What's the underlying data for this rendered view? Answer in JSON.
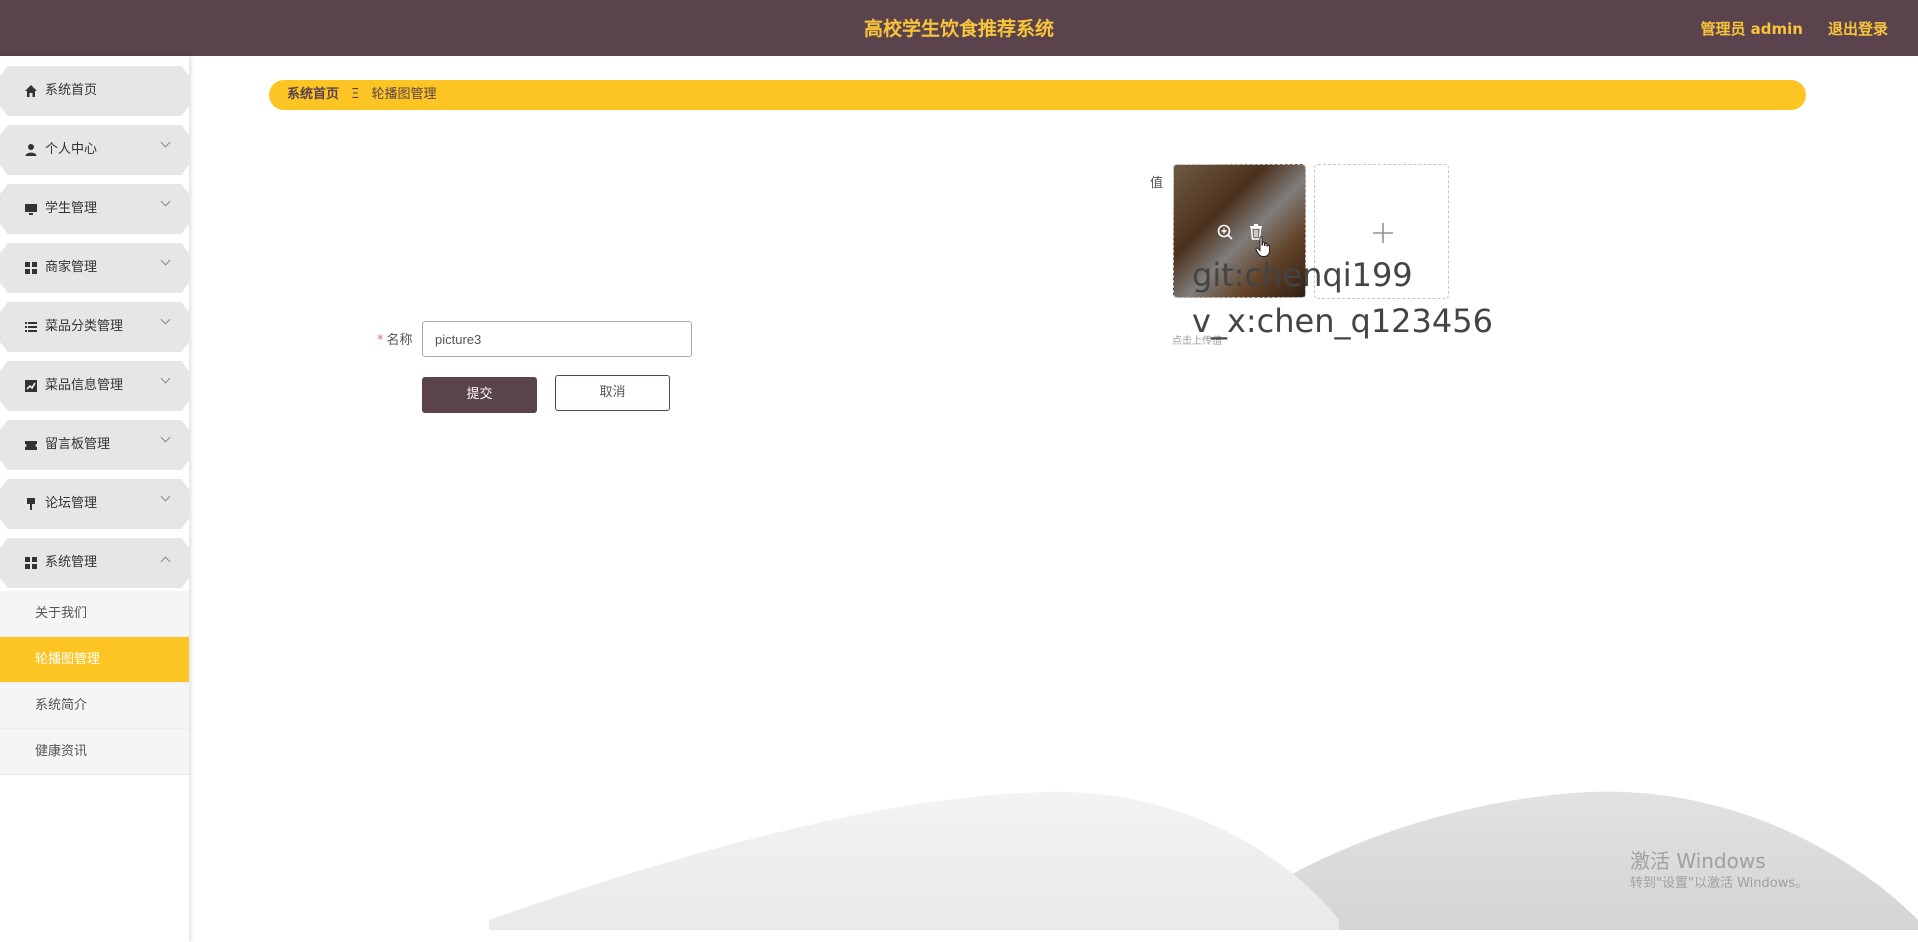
{
  "header": {
    "title": "高校学生饮食推荐系统",
    "admin_label": "管理员 admin",
    "logout_label": "退出登录",
    "bg_color": "#5b434d",
    "accent_color": "#f8c43a"
  },
  "sidebar": {
    "items": [
      {
        "label": "系统首页",
        "icon": "home-icon"
      },
      {
        "label": "个人中心",
        "icon": "user-icon",
        "expandable": true
      },
      {
        "label": "学生管理",
        "icon": "monitor-icon",
        "expandable": true
      },
      {
        "label": "商家管理",
        "icon": "grid-icon",
        "expandable": true
      },
      {
        "label": "菜品分类管理",
        "icon": "list-icon",
        "expandable": true
      },
      {
        "label": "菜品信息管理",
        "icon": "chart-icon",
        "expandable": true
      },
      {
        "label": "留言板管理",
        "icon": "ticket-icon",
        "expandable": true
      },
      {
        "label": "论坛管理",
        "icon": "pin-icon",
        "expandable": true
      },
      {
        "label": "系统管理",
        "icon": "grid-icon",
        "expandable": true,
        "expanded": true
      }
    ],
    "sub_items": [
      {
        "label": "关于我们"
      },
      {
        "label": "轮播图管理",
        "active": true
      },
      {
        "label": "系统简介"
      },
      {
        "label": "健康资讯"
      }
    ],
    "active_color": "#fcc524"
  },
  "breadcrumb": {
    "home": "系统首页",
    "separator": "Ξ",
    "current": "轮播图管理"
  },
  "form": {
    "value_label": "值",
    "upload_hint": "点击上传值",
    "name_label": "名称",
    "name_required_mark": "*",
    "name_value": "picture3",
    "submit_label": "提交",
    "cancel_label": "取消"
  },
  "overlay_text": {
    "line1": "git:chenqi199",
    "line2": "v_x:chen_q123456"
  },
  "windows_watermark": {
    "title": "激活 Windows",
    "subtitle": "转到\"设置\"以激活 Windows。"
  }
}
